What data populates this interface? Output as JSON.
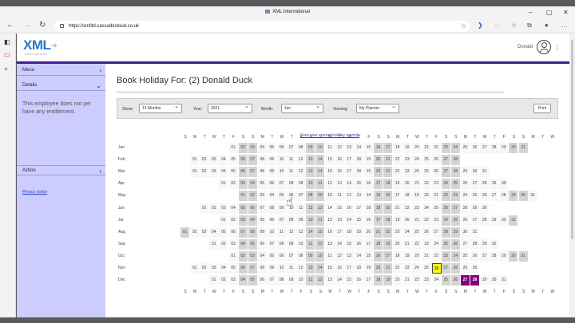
{
  "browser": {
    "window_title": "XML International",
    "url": "https://xmlltd.cascadecloud.co.uk"
  },
  "app": {
    "logo": "XML",
    "logo_sub": "international",
    "user_name": "Donald"
  },
  "sidebar": {
    "menu_label": "Menu",
    "details_label": "Details",
    "details_text": "This employee does not yet have any entitlement.",
    "action_label": "Action",
    "privacy_link": "Privacy notice"
  },
  "main": {
    "title": "Book Holiday For: (2) Donald Duck",
    "filters": {
      "show_label": "Show:",
      "show_value": "12 Months",
      "year_label": "Year:",
      "year_value": "2021",
      "month_label": "Month:",
      "month_value": "Jan",
      "viewing_label": "Viewing:",
      "viewing_value": "My Planner",
      "print_label": "Print"
    },
    "view_link": "View your current holiday records"
  },
  "calendar": {
    "year": 2021,
    "weekday_letters": [
      "S",
      "M",
      "T",
      "W",
      "T",
      "F",
      "S"
    ],
    "months": [
      "Jan",
      "Feb",
      "Mar",
      "Apr",
      "May",
      "Jun",
      "Jul",
      "Aug",
      "Sep",
      "Oct",
      "Nov",
      "Dec"
    ],
    "selected_day": {
      "month": 11,
      "day": 26
    },
    "booked_days": [
      {
        "month": 12,
        "day": 27
      },
      {
        "month": 12,
        "day": 28
      }
    ],
    "colors": {
      "weekend": "#d4d4d4",
      "selected": "#ffff00",
      "booked": "#800080",
      "sidebar": "#ccccff",
      "header_bar": "#3a1f8f"
    }
  }
}
